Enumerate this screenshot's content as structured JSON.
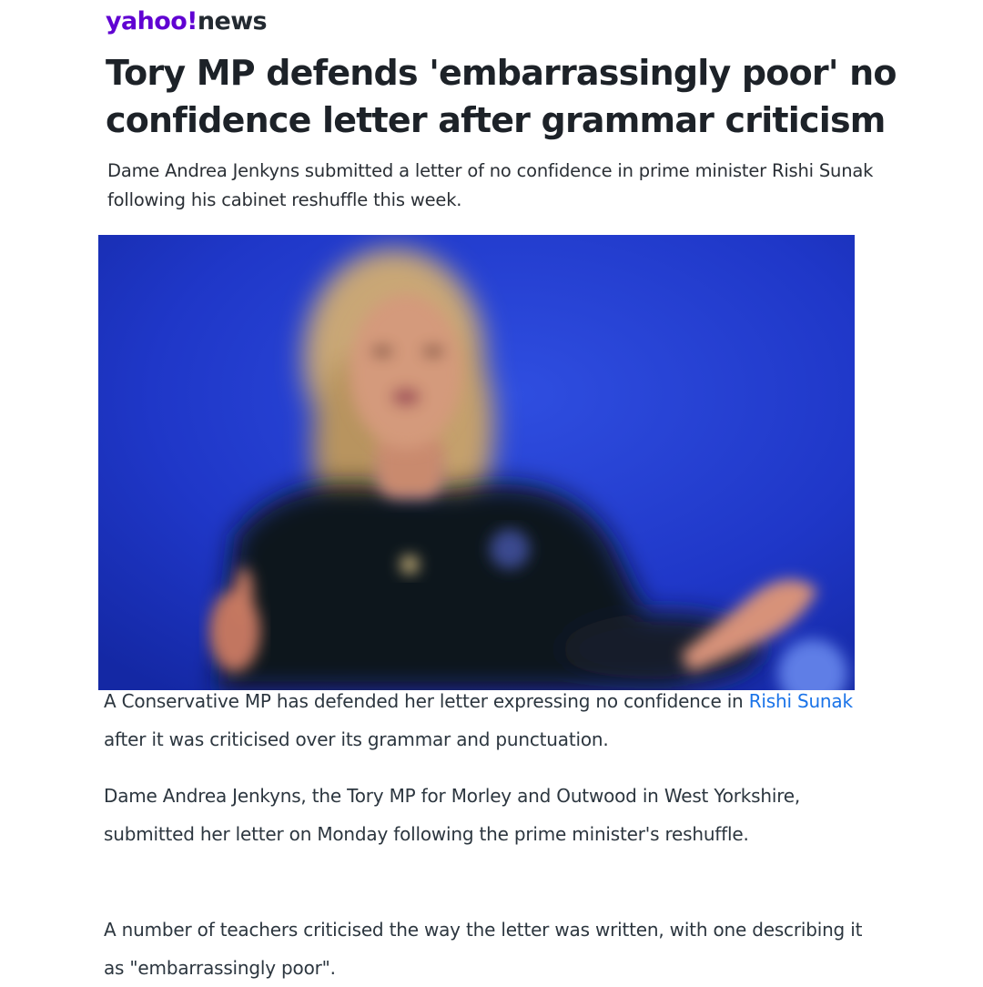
{
  "brand": {
    "logo_yahoo": "yahoo",
    "logo_bang": "!",
    "logo_news": "news",
    "accent_color": "#6001d2",
    "link_color": "#1a73e8"
  },
  "article": {
    "headline": "Tory MP defends 'embarrassingly poor' no confidence letter after grammar criticism",
    "subheadline": "Dame Andrea Jenkyns submitted a letter of no confidence in prime minister Rishi Sunak following his cabinet reshuffle this week.",
    "hero_image": {
      "alt_visual": "blurred photo of a woman with blonde hair in a dark top speaking against a blue background"
    },
    "paragraphs": {
      "p1_before": "A Conservative MP has defended her letter expressing no confidence in ",
      "p1_link": "Rishi Sunak",
      "p1_after": " after it was criticised over its grammar and punctuation.",
      "p2": "Dame Andrea Jenkyns, the Tory MP for Morley and Outwood in West Yorkshire, submitted her letter on Monday following the prime minister's reshuffle.",
      "p3": "A number of teachers criticised the way the letter was written, with one describing it as \"embarrassingly poor\"."
    }
  }
}
